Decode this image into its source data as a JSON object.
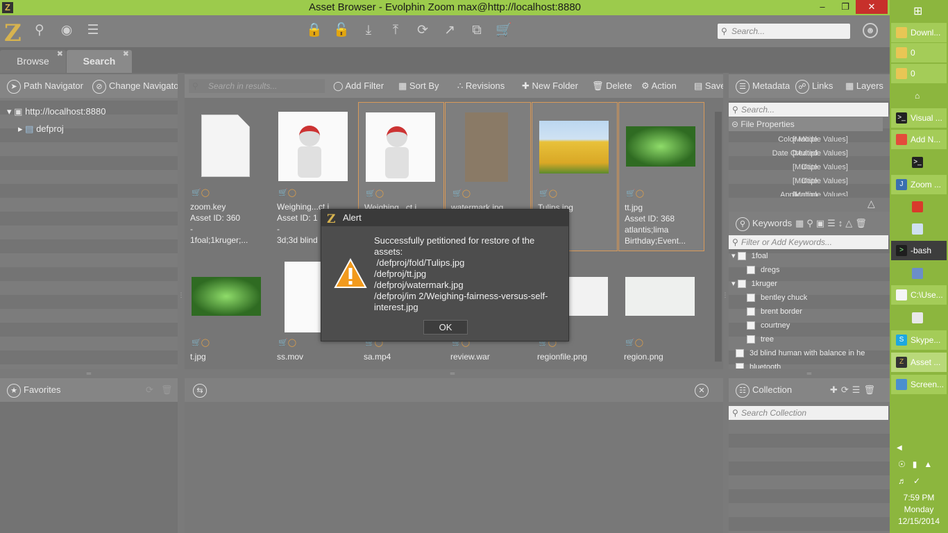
{
  "window": {
    "title": "Asset Browser - Evolphin Zoom max@http://localhost:8880",
    "app_icon": "Z"
  },
  "toolbar": {
    "search_placeholder": "Search...",
    "logo": "Z"
  },
  "tabs": [
    {
      "label": "Browse"
    },
    {
      "label": "Search"
    }
  ],
  "left": {
    "nav_buttons": [
      "Path Navigator",
      "Change Navigator"
    ],
    "tree": {
      "root": "http://localhost:8880",
      "child": "defproj"
    },
    "favorites": "Favorites"
  },
  "center": {
    "search_placeholder": "Search in results...",
    "actions": [
      "Add Filter",
      "Sort By",
      "Revisions",
      "New Folder",
      "Delete",
      "Action",
      "Save"
    ],
    "assets": [
      {
        "name": "zoom.key",
        "id": "Asset ID: 360",
        "line3": "-",
        "line4": "1foal;1kruger;..."
      },
      {
        "name": "Weighing...ct.j",
        "id": "Asset ID: 1",
        "line3": "-",
        "line4": "3d;3d blind"
      },
      {
        "name": "Weighing...ct.j",
        "id": "",
        "line3": "",
        "line4": ""
      },
      {
        "name": "watermark.jpg",
        "id": "",
        "line3": "",
        "line4": ""
      },
      {
        "name": "Tulips.jpg",
        "id": "D: 153",
        "line3": "",
        "line4": ""
      },
      {
        "name": "tt.jpg",
        "id": "Asset ID: 368",
        "line3": "atlantis;lima",
        "line4": "Birthday;Event..."
      },
      {
        "name": "t.jpg"
      },
      {
        "name": "ss.mov"
      },
      {
        "name": "sa.mp4"
      },
      {
        "name": "review.war"
      },
      {
        "name": "regionfile.png"
      },
      {
        "name": "region.png"
      }
    ]
  },
  "right": {
    "tabs": [
      "Metadata",
      "Links",
      "Layers"
    ],
    "search_placeholder": "Search...",
    "section": "File Properties",
    "properties": [
      {
        "k": "Color Mode",
        "v": "[Multiple Values]"
      },
      {
        "k": "Date Created",
        "v": "[Multiple Values]"
      },
      {
        "k": "Date",
        "v": "[Multiple Values]"
      },
      {
        "k": "Date",
        "v": "[Multiple Values]"
      },
      {
        "k": "Application",
        "v": "[Multiple Values]"
      }
    ],
    "keywords_title": "Keywords",
    "keywords_placeholder": "Filter or Add Keywords...",
    "keywords": [
      {
        "label": "1foal",
        "level": 0
      },
      {
        "label": "dregs",
        "level": 1
      },
      {
        "label": "1kruger",
        "level": 0
      },
      {
        "label": "bentley chuck",
        "level": 1
      },
      {
        "label": "brent border",
        "level": 1
      },
      {
        "label": "courtney",
        "level": 1
      },
      {
        "label": "tree",
        "level": 1
      },
      {
        "label": "3d blind human with balance in he",
        "level": 0
      },
      {
        "label": "bluetooth",
        "level": 0
      }
    ],
    "collection_title": "Collection",
    "collection_placeholder": "Search Collection"
  },
  "dialog": {
    "title": "Alert",
    "message": "Successfully petitioned for restore of the assets:\n /defproj/fold/Tulips.jpg\n/defproj/tt.jpg\n/defproj/watermark.jpg\n/defproj/im 2/Weighing-fairness-versus-self-interest.jpg",
    "ok": "OK"
  },
  "taskbar": {
    "items": [
      "Downl...",
      "0",
      "0",
      "",
      "Visual ...",
      "Add N...",
      "",
      "Zoom ...",
      "",
      "",
      "-bash",
      "",
      "C:\\Use...",
      "",
      "Skype...",
      "Asset ...",
      "Screen..."
    ],
    "time": "7:59 PM",
    "day": "Monday",
    "date": "12/15/2014"
  },
  "colors": {
    "accent": "#9ccb4c",
    "selection": "#d89a5a",
    "close": "#c7302b"
  }
}
